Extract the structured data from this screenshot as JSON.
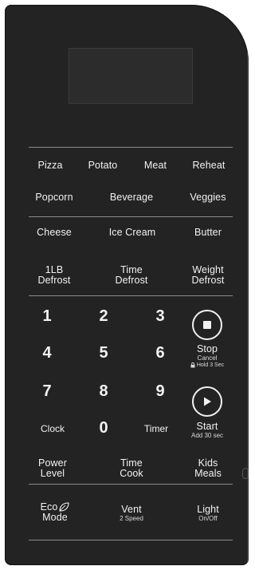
{
  "presets_row1": [
    "Pizza",
    "Potato",
    "Meat",
    "Reheat"
  ],
  "presets_row2": [
    "Popcorn",
    "Beverage",
    "Veggies"
  ],
  "presets_row3": [
    "Cheese",
    "Ice Cream",
    "Butter"
  ],
  "defrost": {
    "lb_line1": "1LB",
    "lb_line2": "Defrost",
    "time_line1": "Time",
    "time_line2": "Defrost",
    "weight_line1": "Weight",
    "weight_line2": "Defrost"
  },
  "numbers": [
    "1",
    "2",
    "3",
    "4",
    "5",
    "6",
    "7",
    "8",
    "9",
    "0"
  ],
  "stop": {
    "label": "Stop",
    "sub1": "Cancel",
    "sub2": "Hold 3 Sec"
  },
  "start": {
    "label": "Start",
    "sub": "Add 30 sec"
  },
  "clock": "Clock",
  "timer": "Timer",
  "power": {
    "line1": "Power",
    "line2": "Level"
  },
  "time_cook": {
    "line1": "Time",
    "line2": "Cook"
  },
  "kids": {
    "line1": "Kids",
    "line2": "Meals"
  },
  "eco": {
    "line1": "Eco",
    "line2": "Mode"
  },
  "vent": {
    "label": "Vent",
    "sub": "2 Speed"
  },
  "light": {
    "label": "Light",
    "sub": "On/Off"
  },
  "colors": {
    "panel": "#232323",
    "text": "#f2f2f2",
    "rule": "#8a8a8a"
  },
  "icons": {
    "stop": "stop-square-icon",
    "start": "play-triangle-icon",
    "eco": "leaf-icon",
    "lock": "lock-icon"
  }
}
